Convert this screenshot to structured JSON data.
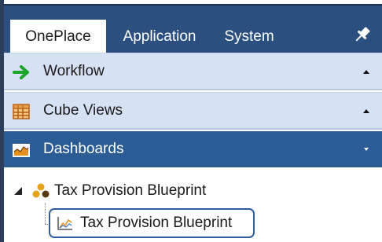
{
  "tabs": [
    {
      "label": "OnePlace",
      "active": true
    },
    {
      "label": "Application",
      "active": false
    },
    {
      "label": "System",
      "active": false
    }
  ],
  "panels": {
    "workflow": {
      "label": "Workflow",
      "icon": "arrow-right-icon",
      "expanded": false
    },
    "cube_views": {
      "label": "Cube Views",
      "icon": "grid-table-icon",
      "expanded": false
    },
    "dashboards": {
      "label": "Dashboards",
      "icon": "dashboard-chart-icon",
      "expanded": true
    }
  },
  "tree": {
    "parent": {
      "label": "Tax Provision Blueprint",
      "icon": "group-dots-icon",
      "expanded": true
    },
    "child": {
      "label": "Tax Provision Blueprint",
      "icon": "line-chart-icon",
      "selected": true
    }
  },
  "colors": {
    "tab_bar": "#2b4f7e",
    "panel_light": "#d6e1f3",
    "panel_dark": "#2b5c96",
    "workflow_arrow": "#1fa52c",
    "selection_border": "#2e5f9c"
  }
}
